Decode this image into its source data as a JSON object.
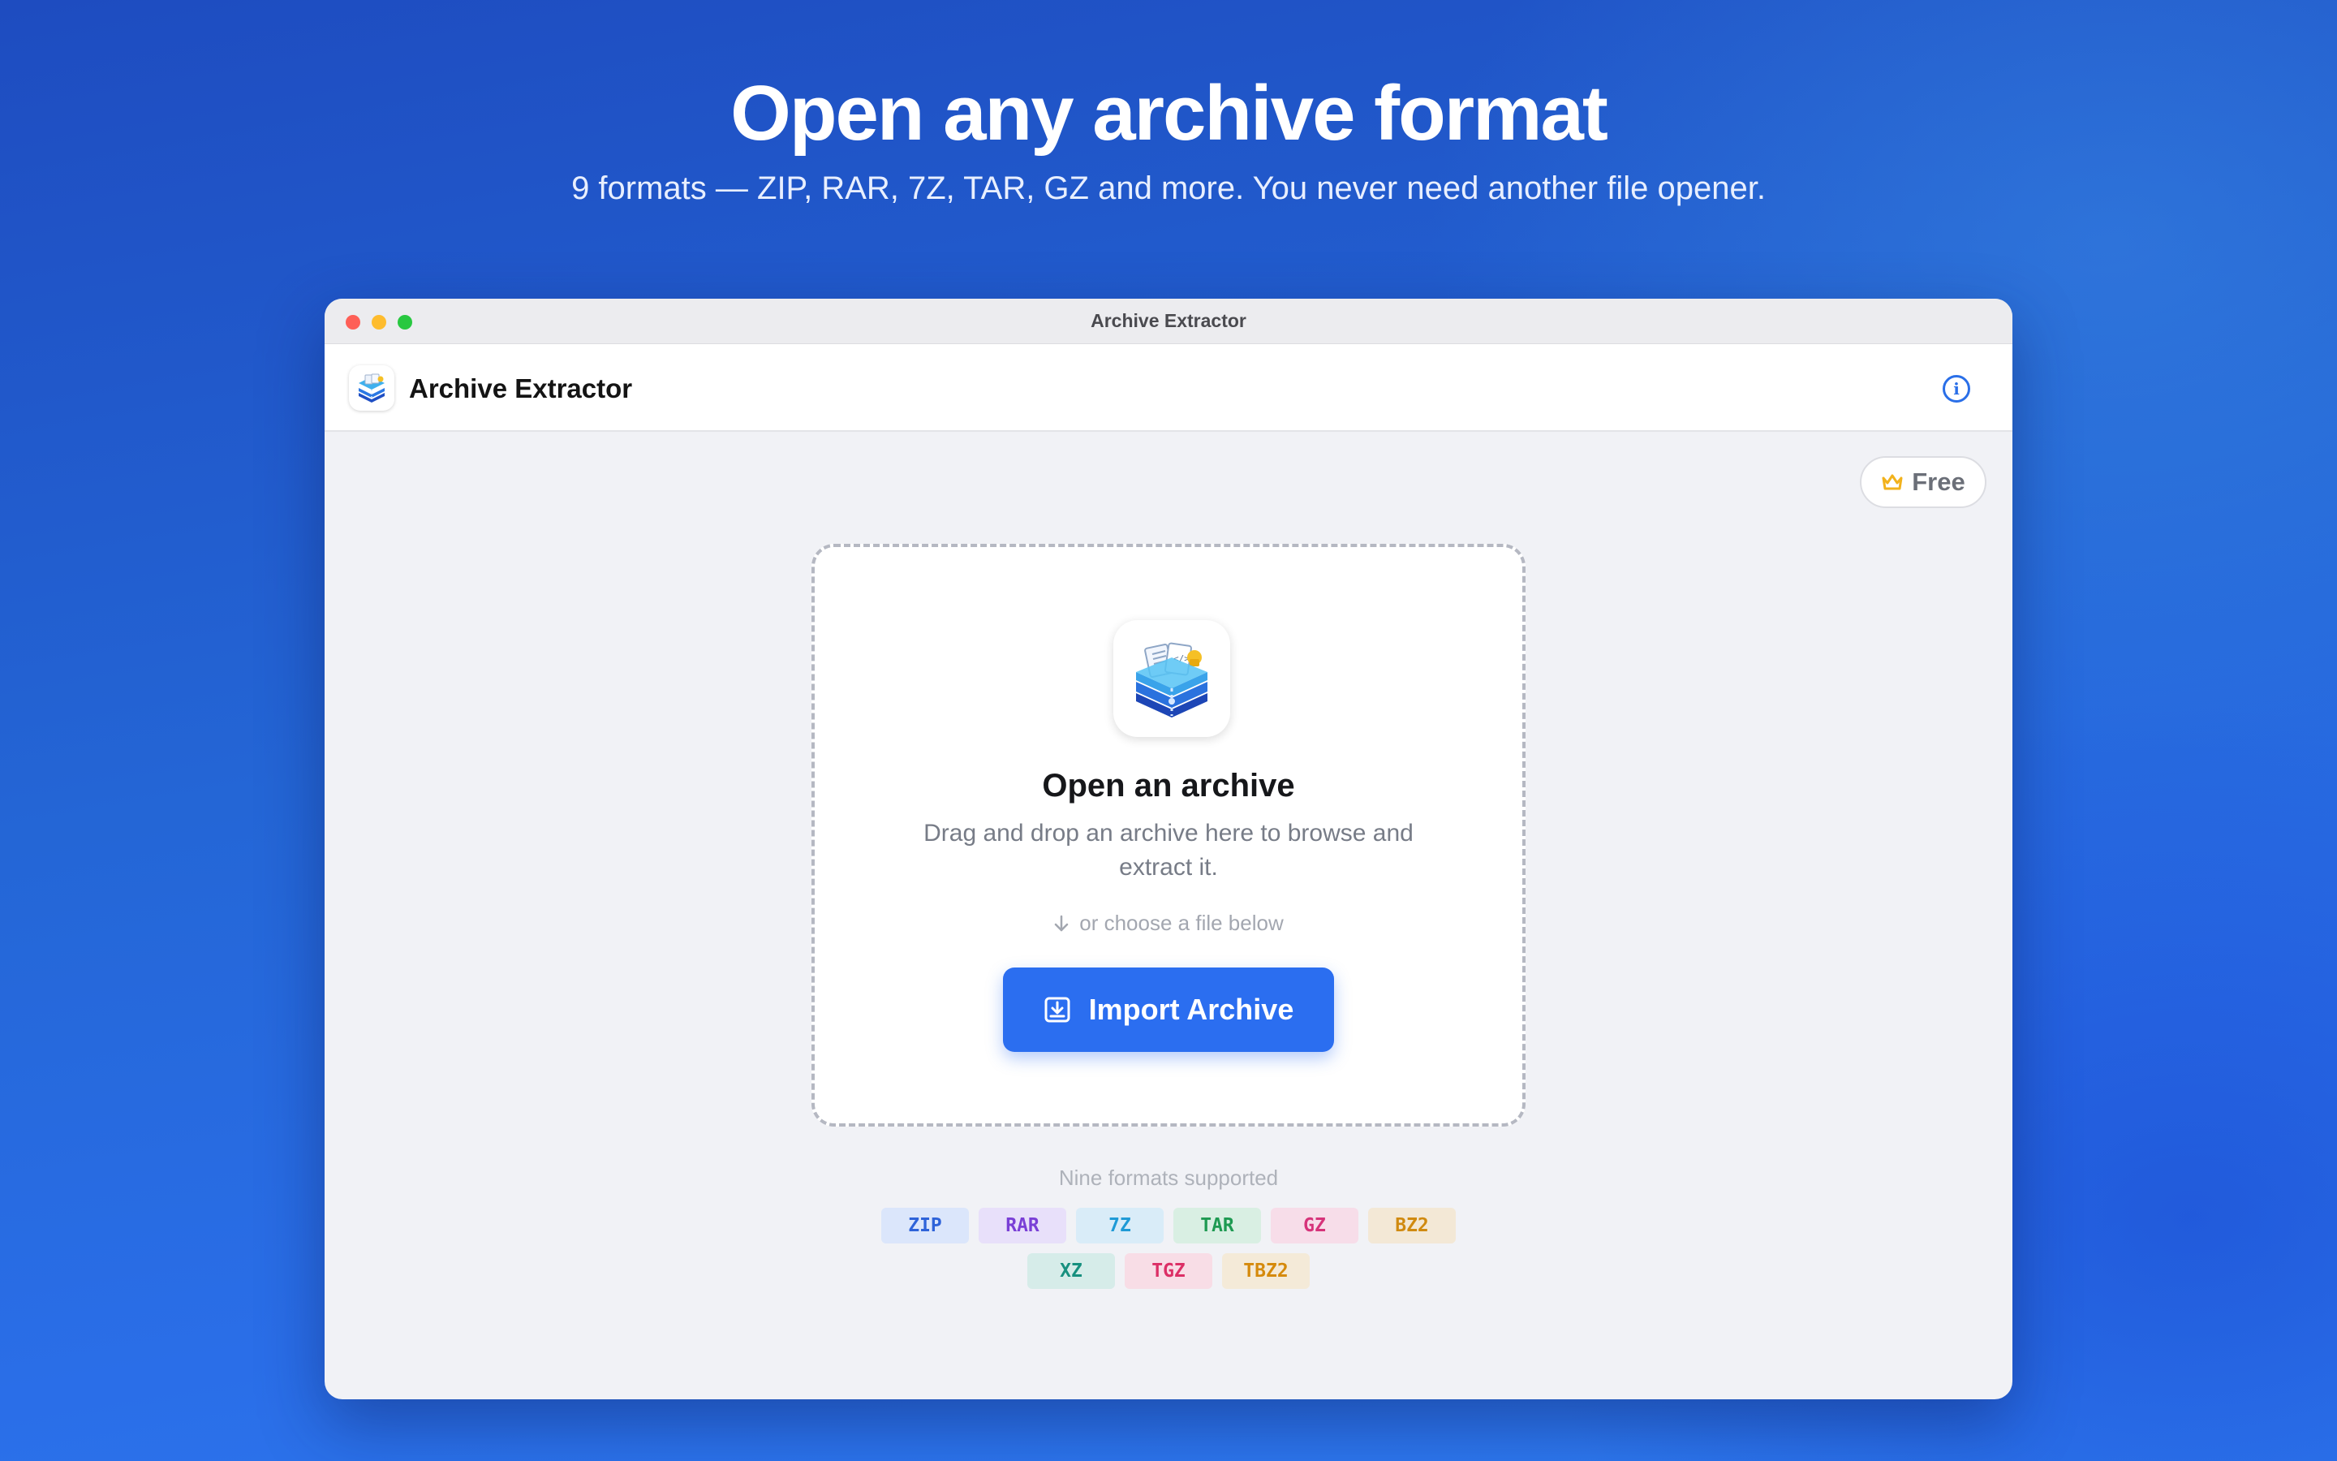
{
  "hero": {
    "title": "Open any archive format",
    "subtitle": "9 formats — ZIP, RAR, 7Z, TAR, GZ and more. You never need another file opener."
  },
  "window": {
    "title": "Archive Extractor",
    "app_name": "Archive Extractor",
    "info_icon": "info-circle-icon",
    "plan_badge": {
      "label": "Free",
      "icon": "crown-icon",
      "icon_color": "#f2b21c"
    }
  },
  "dropzone": {
    "title": "Open an archive",
    "description": "Drag and drop an archive here to browse and extract it.",
    "hint": "or choose a file below",
    "hint_icon": "arrow-down-icon",
    "button_label": "Import Archive",
    "button_icon": "import-icon",
    "accent": "#2b6ef0"
  },
  "formats": {
    "label": "Nine formats supported",
    "rows": [
      [
        {
          "label": "ZIP",
          "bg": "#dbe6fb",
          "fg": "#2e63d9"
        },
        {
          "label": "RAR",
          "bg": "#e8e0fa",
          "fg": "#7a3fd6"
        },
        {
          "label": "7Z",
          "bg": "#d9ecf8",
          "fg": "#1f9ad6"
        },
        {
          "label": "TAR",
          "bg": "#d9efe3",
          "fg": "#1e9a52"
        },
        {
          "label": "GZ",
          "bg": "#f7dde9",
          "fg": "#d6337a"
        },
        {
          "label": "BZ2",
          "bg": "#f3e8d6",
          "fg": "#d08a10"
        }
      ],
      [
        {
          "label": "XZ",
          "bg": "#d6ece9",
          "fg": "#17907f"
        },
        {
          "label": "TGZ",
          "bg": "#f8dde6",
          "fg": "#dc2f66"
        },
        {
          "label": "TBZ2",
          "bg": "#f4ead8",
          "fg": "#d58a0c"
        }
      ]
    ]
  }
}
